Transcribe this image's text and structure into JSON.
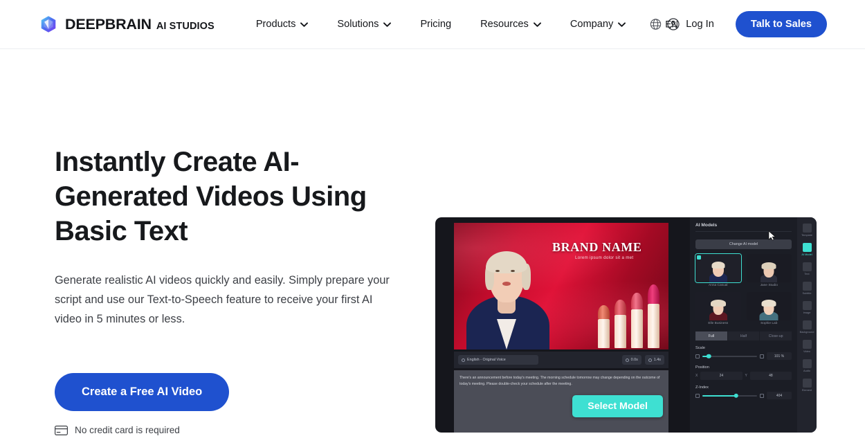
{
  "header": {
    "brand": {
      "icon": "cube-logo-icon",
      "name": "DEEPBRAIN",
      "sub": "AI STUDIOS"
    },
    "nav_items": [
      {
        "label": "Products",
        "has_dropdown": true
      },
      {
        "label": "Solutions",
        "has_dropdown": true
      },
      {
        "label": "Pricing",
        "has_dropdown": false
      },
      {
        "label": "Resources",
        "has_dropdown": true
      },
      {
        "label": "Company",
        "has_dropdown": true
      }
    ],
    "language": {
      "icon": "globe-icon",
      "value": "EN"
    },
    "login": {
      "icon": "user-circle-icon",
      "label": "Log In"
    },
    "cta": {
      "label": "Talk to Sales"
    }
  },
  "hero": {
    "title": "Instantly Create AI-Generated Videos Using Basic Text",
    "paragraph": "Generate realistic AI videos quickly and easily. Simply prepare your script and use our Text-to-Speech feature to receive your first AI video in 5 minutes or less.",
    "cta_label": "Create a Free AI Video",
    "note": {
      "icon": "credit-card-icon",
      "label": "No credit card is required"
    }
  },
  "editor": {
    "stage": {
      "brand_name": "BRAND NAME",
      "brand_tagline": "Lorem ipsum dolor sit a met"
    },
    "toolbar": {
      "voice_chip": "English - Original Voice",
      "time_chip": "0.0s",
      "duration_chip": "1.4s"
    },
    "script": "There's an announcement before today's meeting. The morning schedule tomorrow may change depending on the outcome of today's meeting. Please double-check your schedule after the meeting.",
    "select_model_button": "Select Model",
    "panel": {
      "title": "AI Models",
      "change_model_button": "Change AI model",
      "models": [
        {
          "label": "Anna Casual",
          "active": true
        },
        {
          "label": "Jane Studio",
          "active": false
        },
        {
          "label": "Elle Business",
          "active": false
        },
        {
          "label": "Sophie Lab",
          "active": false
        }
      ],
      "segments": [
        {
          "label": "Full",
          "active": true
        },
        {
          "label": "Half",
          "active": false
        },
        {
          "label": "Close-up",
          "active": false
        }
      ],
      "scale": {
        "label": "Scale",
        "value": "101 %",
        "percent": 12
      },
      "position": {
        "label": "Position",
        "x_axis": "X",
        "x_value": "24",
        "y_axis": "Y",
        "y_value": "48"
      },
      "zindex": {
        "label": "Z-Index",
        "value": "404",
        "percent": 62
      }
    },
    "rail": [
      {
        "label": "Template",
        "icon": "template-icon",
        "active": false
      },
      {
        "label": "AI Model",
        "icon": "person-icon",
        "active": true
      },
      {
        "label": "Text",
        "icon": "text-icon",
        "active": false
      },
      {
        "label": "Subtitle",
        "icon": "subtitle-icon",
        "active": false
      },
      {
        "label": "Image",
        "icon": "image-icon",
        "active": false
      },
      {
        "label": "Background",
        "icon": "background-icon",
        "active": false
      },
      {
        "label": "Video",
        "icon": "video-icon",
        "active": false
      },
      {
        "label": "Audio",
        "icon": "audio-icon",
        "active": false
      },
      {
        "label": "Element",
        "icon": "element-icon",
        "active": false
      }
    ]
  },
  "colors": {
    "brand_blue": "#1f51cf",
    "accent_teal": "#3ee0d2",
    "editor_bg": "#15161c",
    "text_dark": "#17191c"
  }
}
